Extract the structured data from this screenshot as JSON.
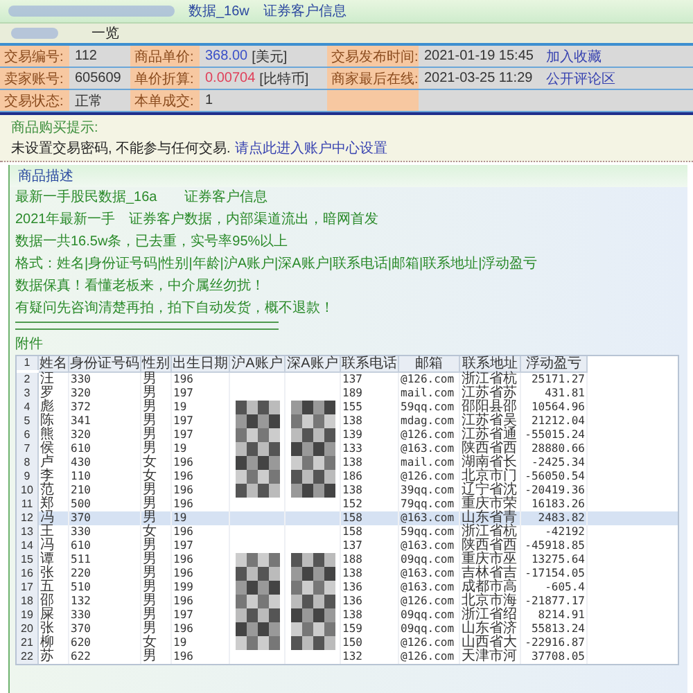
{
  "breadcrumb": {
    "title": "数据_16w",
    "subtitle": "证券客户信息"
  },
  "tabs": [
    {
      "label": "一览",
      "selected": false
    }
  ],
  "info_rows": [
    [
      {
        "label": "交易编号:",
        "value": "112"
      },
      {
        "label": "商品单价:",
        "value": "368.00",
        "unit": "[美元]",
        "color": "#3a4fc8"
      },
      {
        "label": "交易发布时间:",
        "value": "2021-01-19 15:45"
      },
      {
        "link": "加入收藏"
      }
    ],
    [
      {
        "label": "卖家账号:",
        "value": "605609"
      },
      {
        "label": "单价折算:",
        "value": "0.00704",
        "unit": "[比特币]",
        "color": "#e0405a"
      },
      {
        "label": "商家最后在线:",
        "value": "2021-03-25 11:29"
      },
      {
        "link": "公开评论区"
      }
    ],
    [
      {
        "label": "交易状态:",
        "value": "正常"
      },
      {
        "label": "本单成交:",
        "value": "1"
      }
    ]
  ],
  "purchase_tip": {
    "title": "商品购买提示:",
    "text": "未设置交易密码, 不能参与任何交易.",
    "link": "请点此进入账户中心设置"
  },
  "description": {
    "title": "商品描述",
    "lines": [
      "最新一手股民数据_16a　　证券客户信息",
      "2021年最新一手　证券客户数据，内部渠道流出，暗网首发",
      "数据一共16.5w条，已去重，实号率95%以上",
      "格式：姓名|身份证号码|性别|年龄|沪A账户|深A账户|联系电话|邮箱|联系地址|浮动盈亏",
      "数据保真！看懂老板来，中介属丝勿扰！",
      "有疑问先咨询清楚再拍，拍下自动发货，概不退款！"
    ]
  },
  "attachment": {
    "title": "附件",
    "header_row_number": "1",
    "columns": [
      "姓名",
      "身份证号码",
      "性别",
      "出生日期",
      "沪A账户",
      "深A账户",
      "联系电话",
      "邮箱",
      "联系地址",
      "浮动盈亏"
    ],
    "rows": [
      {
        "n": "2",
        "name": "汪",
        "id": "330",
        "gender": "男",
        "birth": "196",
        "phone": "137",
        "email": "@126.com",
        "address": "浙江省杭",
        "amount": "25171.27",
        "pixelated": false,
        "selected": false
      },
      {
        "n": "3",
        "name": "罗",
        "id": "320",
        "gender": "男",
        "birth": "197",
        "phone": "189",
        "email": "mail.com",
        "address": "江苏省苏",
        "amount": "431.81",
        "pixelated": false,
        "selected": false
      },
      {
        "n": "4",
        "name": "彪",
        "id": "372",
        "gender": "男",
        "birth": "19",
        "phone": "155",
        "email": "59qq.com",
        "address": "邵阳县邵",
        "amount": "10564.96",
        "pixelated": true,
        "selected": false
      },
      {
        "n": "5",
        "name": "陈",
        "id": "341",
        "gender": "男",
        "birth": "197",
        "phone": "138",
        "email": "mdag.com",
        "address": "江苏省吴",
        "amount": "21212.04",
        "pixelated": true,
        "selected": false
      },
      {
        "n": "6",
        "name": "熊",
        "id": "320",
        "gender": "男",
        "birth": "197",
        "phone": "139",
        "email": "@126.com",
        "address": "江苏省通",
        "amount": "-55015.24",
        "pixelated": true,
        "selected": false
      },
      {
        "n": "7",
        "name": "侯",
        "id": "610",
        "gender": "男",
        "birth": "19",
        "phone": "133",
        "email": "@163.com",
        "address": "陕西省西",
        "amount": "28880.66",
        "pixelated": true,
        "selected": false
      },
      {
        "n": "8",
        "name": "卢",
        "id": "430",
        "gender": "女",
        "birth": "196",
        "phone": "138",
        "email": "mail.com",
        "address": "湖南省长",
        "amount": "-2425.34",
        "pixelated": true,
        "selected": false
      },
      {
        "n": "9",
        "name": "李",
        "id": "110",
        "gender": "女",
        "birth": "196",
        "phone": "186",
        "email": "@126.com",
        "address": "北京市门",
        "amount": "-56050.54",
        "pixelated": true,
        "selected": false
      },
      {
        "n": "10",
        "name": "范",
        "id": "210",
        "gender": "男",
        "birth": "196",
        "phone": "138",
        "email": "39qq.com",
        "address": "辽宁省沈",
        "amount": "-20419.36",
        "pixelated": true,
        "selected": false
      },
      {
        "n": "11",
        "name": "郑",
        "id": "500",
        "gender": "男",
        "birth": "196",
        "phone": "152",
        "email": "79qq.com",
        "address": "重庆市荣",
        "amount": "16183.26",
        "pixelated": false,
        "selected": false
      },
      {
        "n": "12",
        "name": "冯",
        "id": "370",
        "gender": "男",
        "birth": "19",
        "phone": "158",
        "email": "@163.com",
        "address": "山东省青",
        "amount": "2483.82",
        "pixelated": false,
        "selected": true
      },
      {
        "n": "13",
        "name": "王",
        "id": "330",
        "gender": "女",
        "birth": "196",
        "phone": "158",
        "email": "59qq.com",
        "address": "浙江省杭",
        "amount": "-42192",
        "pixelated": false,
        "selected": false
      },
      {
        "n": "14",
        "name": "冯",
        "id": "610",
        "gender": "男",
        "birth": "197",
        "phone": "137",
        "email": "@163.com",
        "address": "陕西省西",
        "amount": "-45918.85",
        "pixelated": false,
        "selected": false
      },
      {
        "n": "15",
        "name": "谭",
        "id": "511",
        "gender": "男",
        "birth": "196",
        "phone": "188",
        "email": "09qq.com",
        "address": "重庆市巫",
        "amount": "13275.64",
        "pixelated": true,
        "selected": false
      },
      {
        "n": "16",
        "name": "张",
        "id": "220",
        "gender": "男",
        "birth": "196",
        "phone": "138",
        "email": "@163.com",
        "address": "吉林省吉",
        "amount": "-17154.05",
        "pixelated": true,
        "selected": false
      },
      {
        "n": "17",
        "name": "五",
        "id": "510",
        "gender": "男",
        "birth": "199",
        "phone": "136",
        "email": "@163.com",
        "address": "成都市高",
        "amount": "-605.4",
        "pixelated": true,
        "selected": false
      },
      {
        "n": "18",
        "name": "邵",
        "id": "132",
        "gender": "男",
        "birth": "196",
        "phone": "136",
        "email": "@126.com",
        "address": "北京市海",
        "amount": "-21877.17",
        "pixelated": true,
        "selected": false
      },
      {
        "n": "19",
        "name": "屎",
        "id": "330",
        "gender": "男",
        "birth": "197",
        "phone": "138",
        "email": "09qq.com",
        "address": "浙江省绍",
        "amount": "8214.91",
        "pixelated": true,
        "selected": false
      },
      {
        "n": "20",
        "name": "张",
        "id": "370",
        "gender": "男",
        "birth": "196",
        "phone": "159",
        "email": "09qq.com",
        "address": "山东省济",
        "amount": "55813.24",
        "pixelated": true,
        "selected": false
      },
      {
        "n": "21",
        "name": "柳",
        "id": "620",
        "gender": "女",
        "birth": "19",
        "phone": "150",
        "email": "@126.com",
        "address": "山西省大",
        "amount": "-22916.87",
        "pixelated": true,
        "selected": false
      },
      {
        "n": "22",
        "name": "苏",
        "id": "622",
        "gender": "男",
        "birth": "196",
        "phone": "132",
        "email": "@126.com",
        "address": "天津市河",
        "amount": "37708.05",
        "pixelated": false,
        "selected": false
      }
    ]
  }
}
